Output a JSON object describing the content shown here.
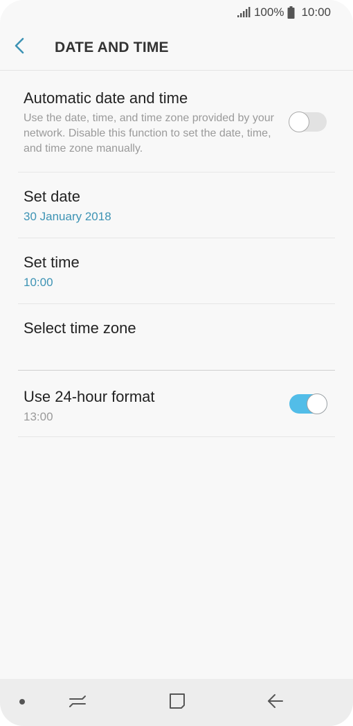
{
  "status_bar": {
    "battery_text": "100%",
    "time": "10:00",
    "icons": [
      "signal-icon",
      "battery-icon"
    ]
  },
  "header": {
    "title": "DATE AND TIME",
    "back_icon": "chevron-left-icon",
    "accent_color": "#3d93b4"
  },
  "settings": {
    "automatic": {
      "title": "Automatic date and time",
      "description": "Use the date, time, and time zone provided by your network. Disable this function to set the date, time, and time zone manually.",
      "enabled": false
    },
    "set_date": {
      "title": "Set date",
      "value": "30 January 2018"
    },
    "set_time": {
      "title": "Set time",
      "value": "10:00"
    },
    "time_zone": {
      "title": "Select time zone"
    },
    "hour_format": {
      "title": "Use 24-hour format",
      "example": "13:00",
      "enabled": true
    }
  },
  "colors": {
    "toggle_on": "#52bde8",
    "toggle_off": "#e2e2e2",
    "value_text": "#3d93b4"
  },
  "nav_bar": {
    "icons": [
      "dot-icon",
      "recent-apps-icon",
      "home-icon",
      "back-arrow-icon"
    ]
  }
}
